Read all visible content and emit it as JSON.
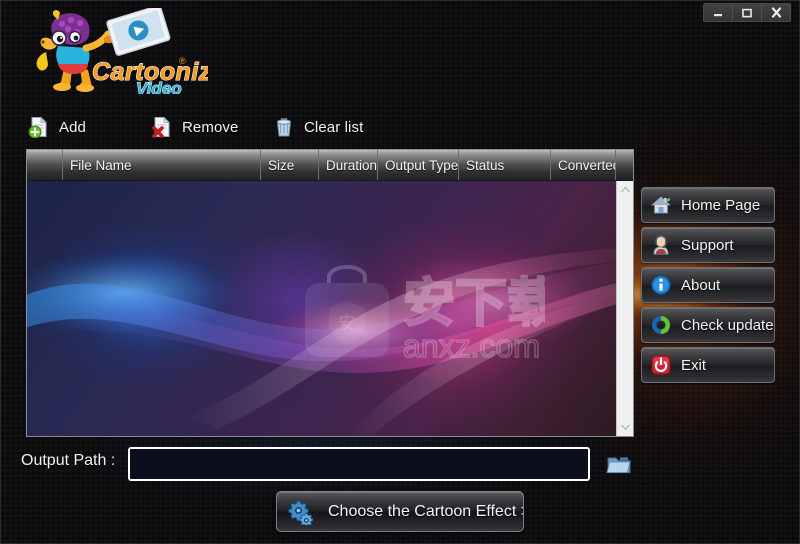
{
  "window": {
    "minimize_label": "Minimize",
    "maximize_label": "Maximize",
    "close_label": "Close"
  },
  "logo": {
    "brand": "Cartoonize",
    "sub": "Video",
    "trademark": "®"
  },
  "toolbar": {
    "items": [
      {
        "label": "Add",
        "icon": "add-file-icon"
      },
      {
        "label": "Remove",
        "icon": "remove-file-icon"
      },
      {
        "label": "Clear list",
        "icon": "trash-icon"
      }
    ]
  },
  "list": {
    "columns": [
      {
        "label": "",
        "width": 36
      },
      {
        "label": "File Name",
        "width": 198
      },
      {
        "label": "Size",
        "width": 58
      },
      {
        "label": "Duration",
        "width": 59
      },
      {
        "label": "Output Type",
        "width": 81
      },
      {
        "label": "Status",
        "width": 92
      },
      {
        "label": "Converted",
        "width": 65
      }
    ],
    "rows": [],
    "watermark": {
      "text_cn": "安下载",
      "text_url": "anxz.com",
      "badge_char": "安"
    },
    "scrollbar": {
      "up_label": "Scroll up",
      "down_label": "Scroll down"
    }
  },
  "side_buttons": [
    {
      "label": "Home Page",
      "icon": "house-icon"
    },
    {
      "label": "Support",
      "icon": "person-headset-icon"
    },
    {
      "label": "About",
      "icon": "info-icon"
    },
    {
      "label": "Check update",
      "icon": "refresh-icon"
    },
    {
      "label": "Exit",
      "icon": "power-icon"
    }
  ],
  "output": {
    "label": "Output Path :",
    "value": "",
    "placeholder": "",
    "browse_icon": "folder-icon"
  },
  "action": {
    "label": "Choose the Cartoon Effect >>>",
    "icon": "gears-icon"
  },
  "colors": {
    "accent_orange": "#ff9628",
    "accent_blue": "#2b82ff",
    "accent_pink": "#ff50aa",
    "panel_border": "#8d8d95",
    "text": "#f2f2f4"
  }
}
